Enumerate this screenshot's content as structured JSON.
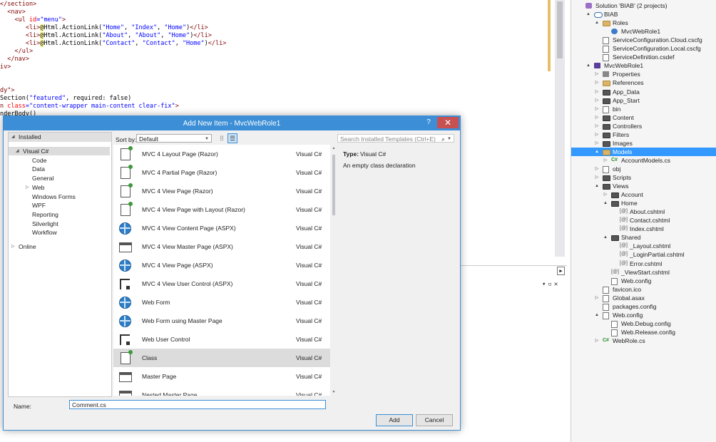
{
  "editor": {
    "lines": [
      {
        "parts": [
          {
            "t": "</section>",
            "c": "tag"
          }
        ]
      },
      {
        "parts": [
          {
            "t": "  <nav>",
            "c": "tag"
          }
        ]
      },
      {
        "parts": [
          {
            "t": "    <ul ",
            "c": "tag"
          },
          {
            "t": "id",
            "c": "attr"
          },
          {
            "t": "=\"menu\"",
            "c": "str"
          },
          {
            "t": ">",
            "c": "tag"
          }
        ]
      },
      {
        "parts": [
          {
            "t": "       <li>",
            "c": "tag"
          },
          {
            "t": "@",
            "c": "razor"
          },
          {
            "t": "Html.ActionLink(",
            "c": "plain"
          },
          {
            "t": "\"Home\"",
            "c": "str"
          },
          {
            "t": ", ",
            "c": "plain"
          },
          {
            "t": "\"Index\"",
            "c": "str"
          },
          {
            "t": ", ",
            "c": "plain"
          },
          {
            "t": "\"Home\"",
            "c": "str"
          },
          {
            "t": ")",
            "c": "plain"
          },
          {
            "t": "</li>",
            "c": "tag"
          }
        ]
      },
      {
        "parts": [
          {
            "t": "       <li>",
            "c": "tag"
          },
          {
            "t": "@",
            "c": "razor"
          },
          {
            "t": "Html.ActionLink(",
            "c": "plain"
          },
          {
            "t": "\"About\"",
            "c": "str"
          },
          {
            "t": ", ",
            "c": "plain"
          },
          {
            "t": "\"About\"",
            "c": "str"
          },
          {
            "t": ", ",
            "c": "plain"
          },
          {
            "t": "\"Home\"",
            "c": "str"
          },
          {
            "t": ")",
            "c": "plain"
          },
          {
            "t": "</li>",
            "c": "tag"
          }
        ]
      },
      {
        "parts": [
          {
            "t": "       <li>",
            "c": "tag"
          },
          {
            "t": "@",
            "c": "razor"
          },
          {
            "t": "Html.ActionLink(",
            "c": "plain"
          },
          {
            "t": "\"Contact\"",
            "c": "str"
          },
          {
            "t": ", ",
            "c": "plain"
          },
          {
            "t": "\"Contact\"",
            "c": "str"
          },
          {
            "t": ", ",
            "c": "plain"
          },
          {
            "t": "\"Home\"",
            "c": "str"
          },
          {
            "t": ")",
            "c": "plain"
          },
          {
            "t": "</li>",
            "c": "tag"
          }
        ]
      },
      {
        "parts": [
          {
            "t": "    </ul>",
            "c": "tag"
          }
        ]
      },
      {
        "parts": [
          {
            "t": "  </nav>",
            "c": "tag"
          }
        ]
      },
      {
        "parts": [
          {
            "t": "iv>",
            "c": "tag"
          }
        ]
      },
      {
        "parts": []
      },
      {
        "parts": []
      },
      {
        "parts": [
          {
            "t": "dy\">",
            "c": "tag"
          }
        ]
      },
      {
        "parts": [
          {
            "t": "Section(",
            "c": "plain"
          },
          {
            "t": "\"featured\"",
            "c": "str"
          },
          {
            "t": ", required: false)",
            "c": "plain"
          }
        ]
      },
      {
        "parts": [
          {
            "t": "n ",
            "c": "tag"
          },
          {
            "t": "class",
            "c": "attr"
          },
          {
            "t": "=\"content-wrapper main-content clear-fix\"",
            "c": "str"
          },
          {
            "t": ">",
            "c": "tag"
          }
        ]
      },
      {
        "parts": [
          {
            "t": "nderBody()",
            "c": "plain"
          }
        ]
      }
    ]
  },
  "solution_explorer": {
    "rows": [
      {
        "label": "Solution 'BIAB' (2 projects)",
        "depth": 0,
        "expander": "",
        "icon": "sol",
        "icon_name": "solution-icon"
      },
      {
        "label": "BIAB",
        "depth": 1,
        "expander": "▲",
        "icon": "cloud",
        "icon_name": "cloud-project-icon"
      },
      {
        "label": "Roles",
        "depth": 2,
        "expander": "▲",
        "icon": "folder",
        "icon_name": "folder-icon"
      },
      {
        "label": "MvcWebRole1",
        "depth": 3,
        "expander": "",
        "icon": "gear",
        "icon_name": "web-role-icon"
      },
      {
        "label": "ServiceConfiguration.Cloud.cscfg",
        "depth": 2,
        "expander": "",
        "icon": "file",
        "icon_name": "config-file-icon"
      },
      {
        "label": "ServiceConfiguration.Local.cscfg",
        "depth": 2,
        "expander": "",
        "icon": "file",
        "icon_name": "config-file-icon"
      },
      {
        "label": "ServiceDefinition.csdef",
        "depth": 2,
        "expander": "",
        "icon": "file",
        "icon_name": "definition-file-icon"
      },
      {
        "label": "MvcWebRole1",
        "depth": 1,
        "expander": "▲",
        "icon": "proj",
        "icon_name": "web-project-icon"
      },
      {
        "label": "Properties",
        "depth": 2,
        "expander": "▷",
        "icon": "wrench",
        "icon_name": "properties-icon"
      },
      {
        "label": "References",
        "depth": 2,
        "expander": "▷",
        "icon": "folder",
        "icon_name": "references-icon"
      },
      {
        "label": "App_Data",
        "depth": 2,
        "expander": "▷",
        "icon": "folder dark",
        "icon_name": "folder-icon"
      },
      {
        "label": "App_Start",
        "depth": 2,
        "expander": "▷",
        "icon": "folder dark",
        "icon_name": "folder-icon"
      },
      {
        "label": "bin",
        "depth": 2,
        "expander": "▷",
        "icon": "file",
        "icon_name": "hidden-folder-icon"
      },
      {
        "label": "Content",
        "depth": 2,
        "expander": "▷",
        "icon": "folder dark",
        "icon_name": "folder-icon"
      },
      {
        "label": "Controllers",
        "depth": 2,
        "expander": "▷",
        "icon": "folder dark",
        "icon_name": "folder-icon"
      },
      {
        "label": "Filters",
        "depth": 2,
        "expander": "▷",
        "icon": "folder dark",
        "icon_name": "folder-icon"
      },
      {
        "label": "Images",
        "depth": 2,
        "expander": "▷",
        "icon": "folder dark",
        "icon_name": "folder-icon"
      },
      {
        "label": "Models",
        "depth": 2,
        "expander": "▲",
        "icon": "folder",
        "icon_name": "folder-icon",
        "selected": true
      },
      {
        "label": "AccountModels.cs",
        "depth": 3,
        "expander": "▷",
        "icon": "cs",
        "icon_name": "csharp-file-icon",
        "icon_text": "C#"
      },
      {
        "label": "obj",
        "depth": 2,
        "expander": "▷",
        "icon": "file",
        "icon_name": "hidden-folder-icon"
      },
      {
        "label": "Scripts",
        "depth": 2,
        "expander": "▷",
        "icon": "folder dark",
        "icon_name": "folder-icon"
      },
      {
        "label": "Views",
        "depth": 2,
        "expander": "▲",
        "icon": "folder dark",
        "icon_name": "folder-icon"
      },
      {
        "label": "Account",
        "depth": 3,
        "expander": "▷",
        "icon": "folder dark",
        "icon_name": "folder-icon"
      },
      {
        "label": "Home",
        "depth": 3,
        "expander": "▲",
        "icon": "folder dark",
        "icon_name": "folder-icon"
      },
      {
        "label": "About.cshtml",
        "depth": 4,
        "expander": "",
        "icon": "cshtml",
        "icon_name": "cshtml-file-icon",
        "icon_text": "[@]"
      },
      {
        "label": "Contact.cshtml",
        "depth": 4,
        "expander": "",
        "icon": "cshtml",
        "icon_name": "cshtml-file-icon",
        "icon_text": "[@]"
      },
      {
        "label": "Index.cshtml",
        "depth": 4,
        "expander": "",
        "icon": "cshtml",
        "icon_name": "cshtml-file-icon",
        "icon_text": "[@]"
      },
      {
        "label": "Shared",
        "depth": 3,
        "expander": "▲",
        "icon": "folder dark",
        "icon_name": "folder-icon"
      },
      {
        "label": "_Layout.cshtml",
        "depth": 4,
        "expander": "",
        "icon": "cshtml",
        "icon_name": "cshtml-file-icon",
        "icon_text": "[@]"
      },
      {
        "label": "_LoginPartial.cshtml",
        "depth": 4,
        "expander": "",
        "icon": "cshtml",
        "icon_name": "cshtml-file-icon",
        "icon_text": "[@]"
      },
      {
        "label": "Error.cshtml",
        "depth": 4,
        "expander": "",
        "icon": "cshtml",
        "icon_name": "cshtml-file-icon",
        "icon_text": "[@]"
      },
      {
        "label": "_ViewStart.cshtml",
        "depth": 3,
        "expander": "",
        "icon": "cshtml",
        "icon_name": "cshtml-file-icon",
        "icon_text": "[@]"
      },
      {
        "label": "Web.config",
        "depth": 3,
        "expander": "",
        "icon": "file",
        "icon_name": "config-file-icon"
      },
      {
        "label": "favicon.ico",
        "depth": 2,
        "expander": "",
        "icon": "file",
        "icon_name": "image-file-icon"
      },
      {
        "label": "Global.asax",
        "depth": 2,
        "expander": "▷",
        "icon": "file",
        "icon_name": "global-asax-icon"
      },
      {
        "label": "packages.config",
        "depth": 2,
        "expander": "",
        "icon": "file",
        "icon_name": "config-file-icon"
      },
      {
        "label": "Web.config",
        "depth": 2,
        "expander": "▲",
        "icon": "file",
        "icon_name": "config-file-icon"
      },
      {
        "label": "Web.Debug.config",
        "depth": 3,
        "expander": "",
        "icon": "file",
        "icon_name": "config-file-icon"
      },
      {
        "label": "Web.Release.config",
        "depth": 3,
        "expander": "",
        "icon": "file",
        "icon_name": "config-file-icon"
      },
      {
        "label": "WebRole.cs",
        "depth": 2,
        "expander": "▷",
        "icon": "cs",
        "icon_name": "csharp-file-icon",
        "icon_text": "C#"
      }
    ]
  },
  "dialog": {
    "title": "Add New Item - MvcWebRole1",
    "help_glyph": "?",
    "close_glyph": "✕",
    "installed_label": "Installed",
    "installed_expander": "◢",
    "tree": [
      {
        "label": "Visual C#",
        "indent": 1,
        "expander": "◢",
        "selected": true
      },
      {
        "label": "Code",
        "indent": 2,
        "expander": ""
      },
      {
        "label": "Data",
        "indent": 2,
        "expander": ""
      },
      {
        "label": "General",
        "indent": 2,
        "expander": ""
      },
      {
        "label": "Web",
        "indent": 2,
        "expander": "▷"
      },
      {
        "label": "Windows Forms",
        "indent": 2,
        "expander": ""
      },
      {
        "label": "WPF",
        "indent": 2,
        "expander": ""
      },
      {
        "label": "Reporting",
        "indent": 2,
        "expander": ""
      },
      {
        "label": "Silverlight",
        "indent": 2,
        "expander": ""
      },
      {
        "label": "Workflow",
        "indent": 2,
        "expander": ""
      },
      {
        "label": "Online",
        "indent": 0,
        "expander": "▷"
      }
    ],
    "sort_by_label": "Sort by:",
    "sort_by_value": "Default",
    "search_placeholder": "Search Installed Templates (Ctrl+E)",
    "templates": [
      {
        "name": "MVC 4 Layout Page (Razor)",
        "lang": "Visual C#",
        "icon": "page",
        "icon_name": "razor-page-icon"
      },
      {
        "name": "MVC 4 Partial Page (Razor)",
        "lang": "Visual C#",
        "icon": "page",
        "icon_name": "razor-page-icon"
      },
      {
        "name": "MVC 4 View Page (Razor)",
        "lang": "Visual C#",
        "icon": "page",
        "icon_name": "razor-page-icon"
      },
      {
        "name": "MVC 4 View Page with Layout (Razor)",
        "lang": "Visual C#",
        "icon": "page",
        "icon_name": "razor-page-icon"
      },
      {
        "name": "MVC 4 View Content Page (ASPX)",
        "lang": "Visual C#",
        "icon": "globe",
        "icon_name": "globe-icon"
      },
      {
        "name": "MVC 4 View Master Page (ASPX)",
        "lang": "Visual C#",
        "icon": "master",
        "icon_name": "master-page-icon"
      },
      {
        "name": "MVC 4 View Page (ASPX)",
        "lang": "Visual C#",
        "icon": "globe",
        "icon_name": "globe-icon"
      },
      {
        "name": "MVC 4 View User Control (ASPX)",
        "lang": "Visual C#",
        "icon": "control",
        "icon_name": "user-control-icon"
      },
      {
        "name": "Web Form",
        "lang": "Visual C#",
        "icon": "globe",
        "icon_name": "globe-icon"
      },
      {
        "name": "Web Form using Master Page",
        "lang": "Visual C#",
        "icon": "globe",
        "icon_name": "globe-icon"
      },
      {
        "name": "Web User Control",
        "lang": "Visual C#",
        "icon": "control",
        "icon_name": "user-control-icon"
      },
      {
        "name": "Class",
        "lang": "Visual C#",
        "icon": "page",
        "icon_name": "class-icon",
        "selected": true
      },
      {
        "name": "Master Page",
        "lang": "Visual C#",
        "icon": "master",
        "icon_name": "master-page-icon"
      },
      {
        "name": "Nested Master Page",
        "lang": "Visual C#",
        "icon": "master",
        "icon_name": "master-page-icon"
      }
    ],
    "type_label": "Type:",
    "type_value": "Visual C#",
    "description": "An empty class declaration",
    "name_label": "Name:",
    "name_value": "Comment.cs",
    "add_label": "Add",
    "cancel_label": "Cancel"
  },
  "colors": {
    "dialog_accent": "#3c8fd6",
    "close_red": "#c75050",
    "selection_blue": "#3399ff"
  }
}
